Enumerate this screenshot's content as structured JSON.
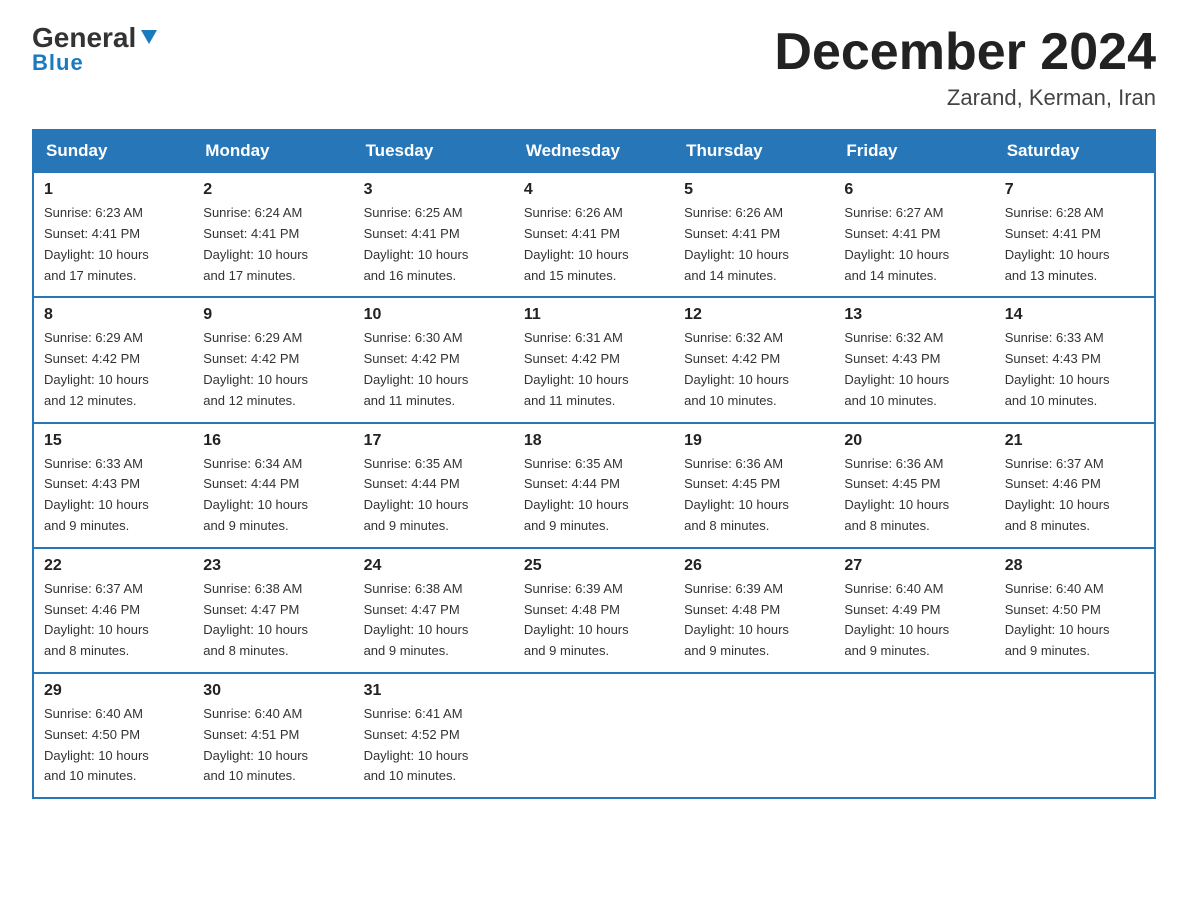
{
  "logo": {
    "general": "General",
    "blue": "Blue"
  },
  "header": {
    "title": "December 2024",
    "location": "Zarand, Kerman, Iran"
  },
  "weekdays": [
    "Sunday",
    "Monday",
    "Tuesday",
    "Wednesday",
    "Thursday",
    "Friday",
    "Saturday"
  ],
  "weeks": [
    [
      {
        "day": "1",
        "sunrise": "6:23 AM",
        "sunset": "4:41 PM",
        "daylight": "10 hours and 17 minutes."
      },
      {
        "day": "2",
        "sunrise": "6:24 AM",
        "sunset": "4:41 PM",
        "daylight": "10 hours and 17 minutes."
      },
      {
        "day": "3",
        "sunrise": "6:25 AM",
        "sunset": "4:41 PM",
        "daylight": "10 hours and 16 minutes."
      },
      {
        "day": "4",
        "sunrise": "6:26 AM",
        "sunset": "4:41 PM",
        "daylight": "10 hours and 15 minutes."
      },
      {
        "day": "5",
        "sunrise": "6:26 AM",
        "sunset": "4:41 PM",
        "daylight": "10 hours and 14 minutes."
      },
      {
        "day": "6",
        "sunrise": "6:27 AM",
        "sunset": "4:41 PM",
        "daylight": "10 hours and 14 minutes."
      },
      {
        "day": "7",
        "sunrise": "6:28 AM",
        "sunset": "4:41 PM",
        "daylight": "10 hours and 13 minutes."
      }
    ],
    [
      {
        "day": "8",
        "sunrise": "6:29 AM",
        "sunset": "4:42 PM",
        "daylight": "10 hours and 12 minutes."
      },
      {
        "day": "9",
        "sunrise": "6:29 AM",
        "sunset": "4:42 PM",
        "daylight": "10 hours and 12 minutes."
      },
      {
        "day": "10",
        "sunrise": "6:30 AM",
        "sunset": "4:42 PM",
        "daylight": "10 hours and 11 minutes."
      },
      {
        "day": "11",
        "sunrise": "6:31 AM",
        "sunset": "4:42 PM",
        "daylight": "10 hours and 11 minutes."
      },
      {
        "day": "12",
        "sunrise": "6:32 AM",
        "sunset": "4:42 PM",
        "daylight": "10 hours and 10 minutes."
      },
      {
        "day": "13",
        "sunrise": "6:32 AM",
        "sunset": "4:43 PM",
        "daylight": "10 hours and 10 minutes."
      },
      {
        "day": "14",
        "sunrise": "6:33 AM",
        "sunset": "4:43 PM",
        "daylight": "10 hours and 10 minutes."
      }
    ],
    [
      {
        "day": "15",
        "sunrise": "6:33 AM",
        "sunset": "4:43 PM",
        "daylight": "10 hours and 9 minutes."
      },
      {
        "day": "16",
        "sunrise": "6:34 AM",
        "sunset": "4:44 PM",
        "daylight": "10 hours and 9 minutes."
      },
      {
        "day": "17",
        "sunrise": "6:35 AM",
        "sunset": "4:44 PM",
        "daylight": "10 hours and 9 minutes."
      },
      {
        "day": "18",
        "sunrise": "6:35 AM",
        "sunset": "4:44 PM",
        "daylight": "10 hours and 9 minutes."
      },
      {
        "day": "19",
        "sunrise": "6:36 AM",
        "sunset": "4:45 PM",
        "daylight": "10 hours and 8 minutes."
      },
      {
        "day": "20",
        "sunrise": "6:36 AM",
        "sunset": "4:45 PM",
        "daylight": "10 hours and 8 minutes."
      },
      {
        "day": "21",
        "sunrise": "6:37 AM",
        "sunset": "4:46 PM",
        "daylight": "10 hours and 8 minutes."
      }
    ],
    [
      {
        "day": "22",
        "sunrise": "6:37 AM",
        "sunset": "4:46 PM",
        "daylight": "10 hours and 8 minutes."
      },
      {
        "day": "23",
        "sunrise": "6:38 AM",
        "sunset": "4:47 PM",
        "daylight": "10 hours and 8 minutes."
      },
      {
        "day": "24",
        "sunrise": "6:38 AM",
        "sunset": "4:47 PM",
        "daylight": "10 hours and 9 minutes."
      },
      {
        "day": "25",
        "sunrise": "6:39 AM",
        "sunset": "4:48 PM",
        "daylight": "10 hours and 9 minutes."
      },
      {
        "day": "26",
        "sunrise": "6:39 AM",
        "sunset": "4:48 PM",
        "daylight": "10 hours and 9 minutes."
      },
      {
        "day": "27",
        "sunrise": "6:40 AM",
        "sunset": "4:49 PM",
        "daylight": "10 hours and 9 minutes."
      },
      {
        "day": "28",
        "sunrise": "6:40 AM",
        "sunset": "4:50 PM",
        "daylight": "10 hours and 9 minutes."
      }
    ],
    [
      {
        "day": "29",
        "sunrise": "6:40 AM",
        "sunset": "4:50 PM",
        "daylight": "10 hours and 10 minutes."
      },
      {
        "day": "30",
        "sunrise": "6:40 AM",
        "sunset": "4:51 PM",
        "daylight": "10 hours and 10 minutes."
      },
      {
        "day": "31",
        "sunrise": "6:41 AM",
        "sunset": "4:52 PM",
        "daylight": "10 hours and 10 minutes."
      },
      null,
      null,
      null,
      null
    ]
  ],
  "labels": {
    "sunrise": "Sunrise:",
    "sunset": "Sunset:",
    "daylight": "Daylight:"
  }
}
